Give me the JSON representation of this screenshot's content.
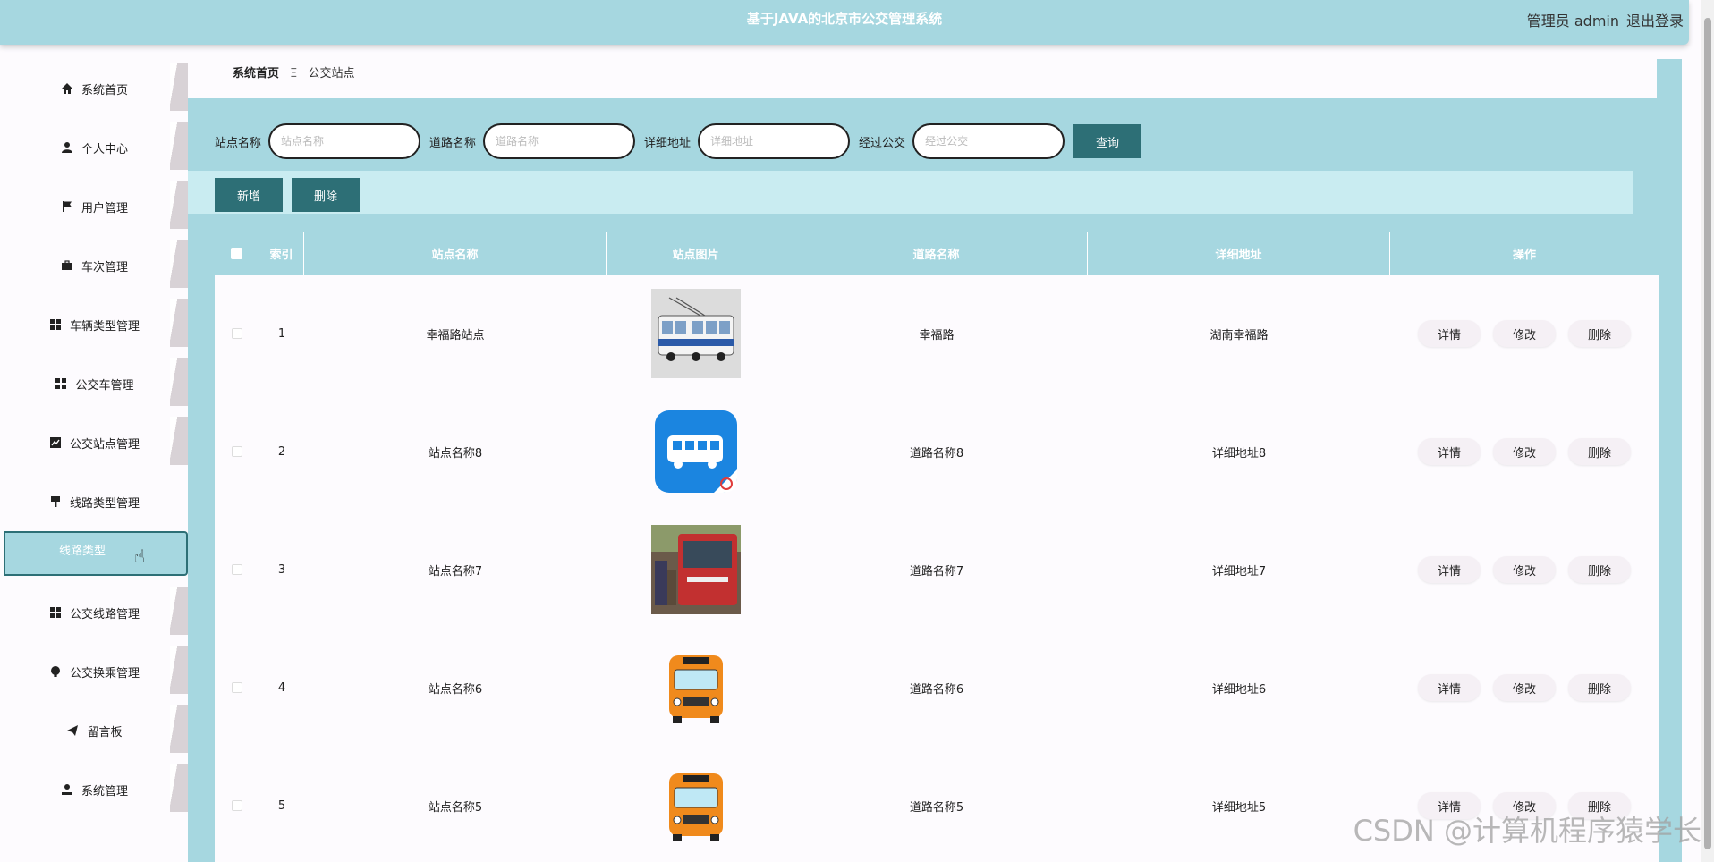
{
  "header": {
    "title": "基于JAVA的北京市公交管理系统",
    "user": "管理员 admin",
    "logout": "退出登录"
  },
  "sidebar": {
    "items": [
      {
        "label": "系统首页",
        "icon": "home-icon"
      },
      {
        "label": "个人中心",
        "icon": "user-icon"
      },
      {
        "label": "用户管理",
        "icon": "flag-icon"
      },
      {
        "label": "车次管理",
        "icon": "briefcase-icon"
      },
      {
        "label": "车辆类型管理",
        "icon": "grid-icon"
      },
      {
        "label": "公交车管理",
        "icon": "grid-icon"
      },
      {
        "label": "公交站点管理",
        "icon": "chart-icon"
      },
      {
        "label": "线路类型管理",
        "icon": "paint-icon"
      },
      {
        "label": "公交线路管理",
        "icon": "grid-icon"
      },
      {
        "label": "公交换乘管理",
        "icon": "bulb-icon"
      },
      {
        "label": "留言板",
        "icon": "send-icon"
      },
      {
        "label": "系统管理",
        "icon": "admin-icon"
      }
    ],
    "sub_item": "线路类型"
  },
  "breadcrumb": {
    "home": "系统首页",
    "sep": "Ξ",
    "current": "公交站点"
  },
  "search": {
    "fields": [
      {
        "label": "站点名称",
        "placeholder": "站点名称"
      },
      {
        "label": "道路名称",
        "placeholder": "道路名称"
      },
      {
        "label": "详细地址",
        "placeholder": "详细地址"
      },
      {
        "label": "经过公交",
        "placeholder": "经过公交"
      }
    ],
    "query_label": "查询"
  },
  "toolbar": {
    "add_label": "新增",
    "delete_label": "删除"
  },
  "table": {
    "columns": [
      "索引",
      "站点名称",
      "站点图片",
      "道路名称",
      "详细地址",
      "操作"
    ],
    "rows": [
      {
        "index": "1",
        "name": "幸福路站点",
        "image": "trolleybus-photo",
        "road": "幸福路",
        "address": "湖南幸福路"
      },
      {
        "index": "2",
        "name": "站点名称8",
        "image": "blue-bus-app-icon",
        "road": "道路名称8",
        "address": "详细地址8"
      },
      {
        "index": "3",
        "name": "站点名称7",
        "image": "red-bus-photo",
        "road": "道路名称7",
        "address": "详细地址7"
      },
      {
        "index": "4",
        "name": "站点名称6",
        "image": "orange-bus-clipart",
        "road": "道路名称6",
        "address": "详细地址6"
      },
      {
        "index": "5",
        "name": "站点名称5",
        "image": "orange-bus-clipart",
        "road": "道路名称5",
        "address": "详细地址5"
      }
    ],
    "actions": [
      "详情",
      "修改",
      "删除"
    ]
  },
  "watermark": "CSDN @计算机程序猿学长",
  "colors": {
    "accent": "#a6d7e0",
    "button": "#2d6f76",
    "background": "#fdfbfe"
  }
}
